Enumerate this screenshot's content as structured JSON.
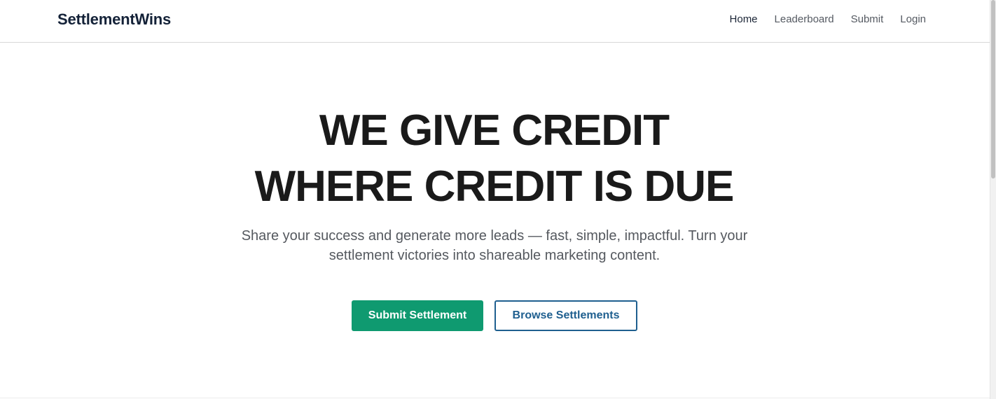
{
  "brand": {
    "name": "SettlementWins"
  },
  "nav": {
    "items": [
      {
        "label": "Home",
        "active": true
      },
      {
        "label": "Leaderboard",
        "active": false
      },
      {
        "label": "Submit",
        "active": false
      },
      {
        "label": "Login",
        "active": false
      }
    ]
  },
  "hero": {
    "headline_line1": "WE GIVE CREDIT",
    "headline_line2": "WHERE CREDIT IS DUE",
    "subtitle": "Share your success and generate more leads — fast, simple, impactful. Turn your settlement victories into shareable marketing content.",
    "primary_button": "Submit Settlement",
    "secondary_button": "Browse Settlements"
  },
  "colors": {
    "primary": "#0f9a70",
    "secondary": "#1f5f8f",
    "text_dark": "#1a1a1a",
    "text_muted": "#55595f"
  }
}
